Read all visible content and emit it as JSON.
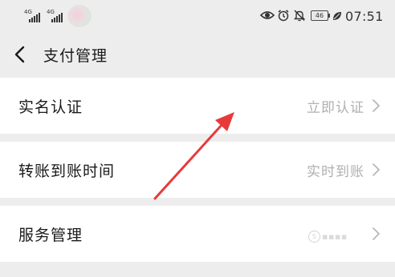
{
  "status_bar": {
    "sim1_label": "4G",
    "sim2_label": "4G",
    "battery_level": "46",
    "time": "07:51",
    "icons": [
      "eye-comfort-icon",
      "alarm-icon",
      "mute-bell-icon",
      "battery-icon",
      "leaf-icon"
    ]
  },
  "header": {
    "back_icon": "chevron-left-icon",
    "title": "支付管理"
  },
  "settings": {
    "items": [
      {
        "label": "实名认证",
        "value": "立即认证",
        "icon": "chevron-right-icon"
      },
      {
        "label": "转账到账时间",
        "value": "实时到账",
        "icon": "chevron-right-icon"
      },
      {
        "label": "服务管理",
        "value": "",
        "icon": "chevron-right-icon"
      }
    ]
  },
  "annotation": {
    "type": "arrow",
    "color": "#e8393a"
  },
  "colors": {
    "background": "#ededed",
    "row_background": "#ffffff",
    "primary_text": "#1a1a1a",
    "secondary_text": "#b0b0b0"
  }
}
